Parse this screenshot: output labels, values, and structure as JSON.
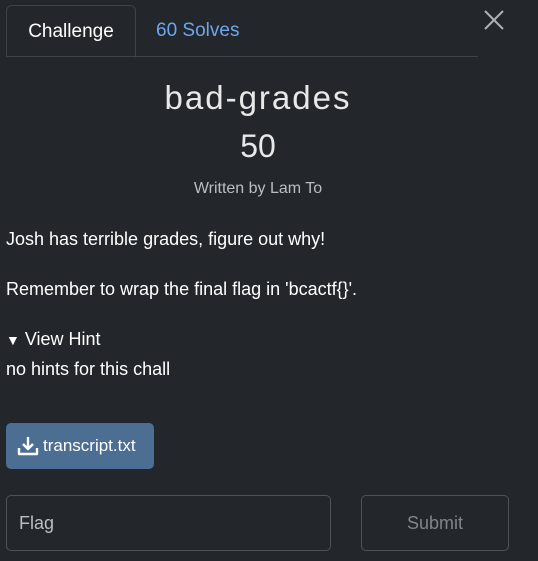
{
  "tabs": {
    "challenge": "Challenge",
    "solves": "60 Solves"
  },
  "challenge": {
    "name": "bad-grades",
    "points": "50",
    "author": "Written by Lam To",
    "description": [
      "Josh has terrible grades, figure out why!",
      "Remember to wrap the final flag in 'bcactf{}'."
    ]
  },
  "hint": {
    "toggle_icon": "▼",
    "toggle_label": "View Hint",
    "text": "no hints for this chall"
  },
  "file": {
    "icon": "download-icon",
    "label": "transcript.txt"
  },
  "flag_input": {
    "placeholder": "Flag",
    "value": ""
  },
  "submit": {
    "label": "Submit"
  },
  "colors": {
    "background": "#23272b",
    "accent_link": "#6ea6ec",
    "file_button": "#4d6e93",
    "border": "#3c434a"
  }
}
